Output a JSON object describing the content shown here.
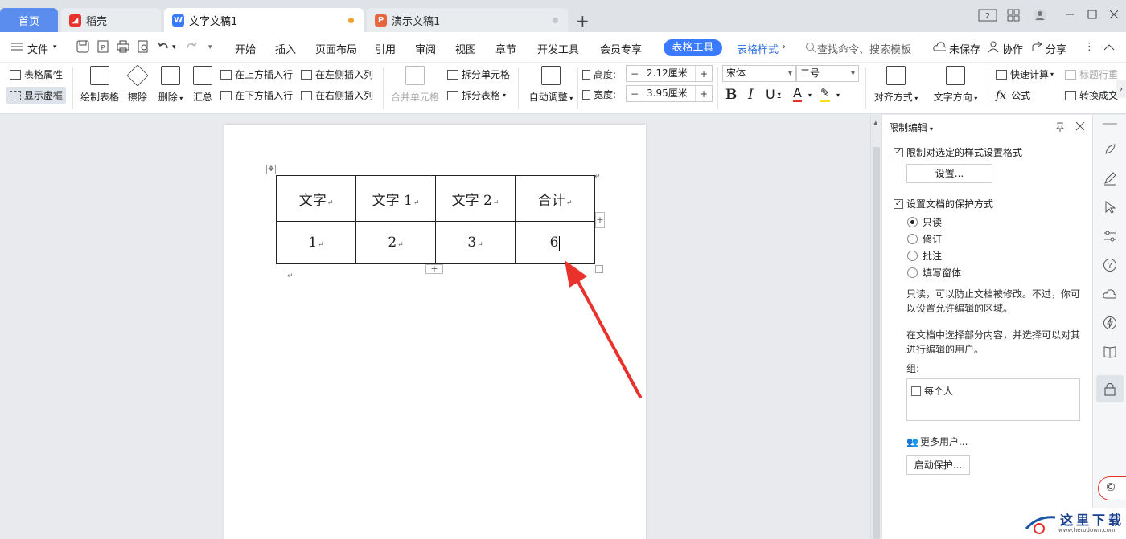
{
  "tabs": {
    "home": "首页",
    "daoke": "稻壳",
    "doc": "文字文稿1",
    "ppt": "演示文稿1",
    "plus": "+"
  },
  "menubar": {
    "file": "文件",
    "items": [
      "开始",
      "插入",
      "页面布局",
      "引用",
      "审阅",
      "视图",
      "章节",
      "开发工具",
      "会员专享"
    ],
    "table_tools": "表格工具",
    "table_style": "表格样式",
    "search": "查找命令、搜索模板",
    "unsaved": "未保存",
    "collab": "协作",
    "share": "分享"
  },
  "ribbon": {
    "table_props": "表格属性",
    "show_gridlines": "显示虚框",
    "draw_table": "绘制表格",
    "erase": "擦除",
    "delete": "删除",
    "summary": "汇总",
    "insert_above": "在上方插入行",
    "insert_below": "在下方插入行",
    "insert_left": "在左侧插入列",
    "insert_right": "在右侧插入列",
    "merge_cells": "合并单元格",
    "split_cells": "拆分单元格",
    "split_table": "拆分表格",
    "auto_fit": "自动调整",
    "height_label": "高度:",
    "height_value": "2.12厘米",
    "width_label": "宽度:",
    "width_value": "3.95厘米",
    "font": "宋体",
    "font_size": "二号",
    "align": "对齐方式",
    "text_dir": "文字方向",
    "quick_calc": "快速计算",
    "title_row": "标题行重",
    "formula": "公式",
    "convert": "转换成文"
  },
  "table": {
    "row1": [
      "文字",
      "文字 1",
      "文字 2",
      "合计"
    ],
    "row2": [
      "1",
      "2",
      "3",
      "6"
    ]
  },
  "panel": {
    "title": "限制编辑",
    "restrict_format": "限制对选定的样式设置格式",
    "settings_btn": "设置...",
    "protect_method": "设置文档的保护方式",
    "options": [
      "只读",
      "修订",
      "批注",
      "填写窗体"
    ],
    "desc1": "只读，可以防止文档被修改。不过，你可以设置允许编辑的区域。",
    "desc2": "在文档中选择部分内容，并选择可以对其进行编辑的用户。",
    "group_label": "组:",
    "everyone": "每个人",
    "more_users": "更多用户...",
    "start_protect": "启动保护..."
  },
  "watermark": {
    "name": "这里下载",
    "url": "www.herodown.com"
  },
  "colors": {
    "accent": "#3a7afe",
    "arrow": "#e8322b",
    "home_tab": "#5b8def",
    "wps_doc": "#3a7afe",
    "ppt": "#e8663c",
    "daoke": "#e8322b"
  }
}
